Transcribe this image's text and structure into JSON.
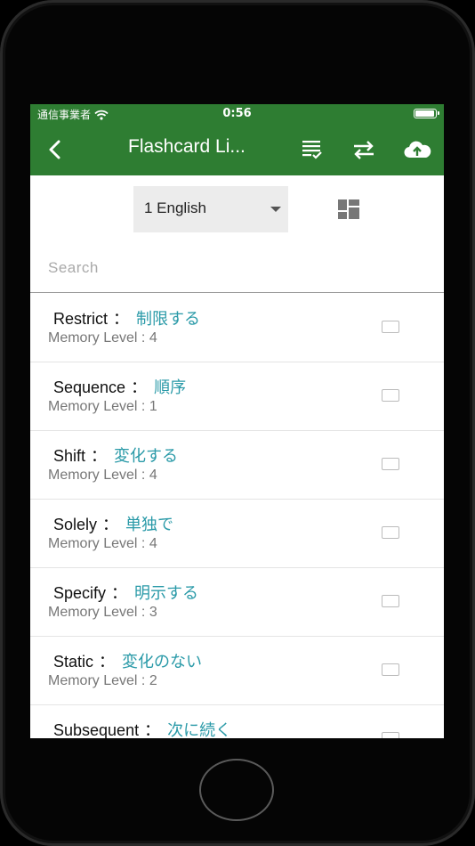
{
  "status_bar": {
    "carrier": "通信事業者",
    "time": "0:56",
    "battery_level": 1.0
  },
  "app_bar": {
    "title": "Flashcard Li...",
    "icons": [
      "back-icon",
      "list-check-icon",
      "swap-icon",
      "cloud-upload-icon"
    ]
  },
  "selector": {
    "selected": "1 English"
  },
  "search": {
    "placeholder": "Search",
    "value": ""
  },
  "cards": [
    {
      "word": "Restrict",
      "meaning": "制限する",
      "level_label": "Memory Level : 4"
    },
    {
      "word": "Sequence",
      "meaning": "順序",
      "level_label": "Memory Level : 1"
    },
    {
      "word": "Shift",
      "meaning": "変化する",
      "level_label": "Memory Level : 4"
    },
    {
      "word": "Solely",
      "meaning": "単独で",
      "level_label": "Memory Level : 4"
    },
    {
      "word": "Specify",
      "meaning": "明示する",
      "level_label": "Memory Level : 3"
    },
    {
      "word": "Static",
      "meaning": "変化のない",
      "level_label": "Memory Level : 2"
    },
    {
      "word": "Subsequent",
      "meaning": "次に続く",
      "level_label": ""
    }
  ],
  "colors": {
    "primary": "#2e7d32",
    "meaning_text": "#2a9aa8"
  }
}
